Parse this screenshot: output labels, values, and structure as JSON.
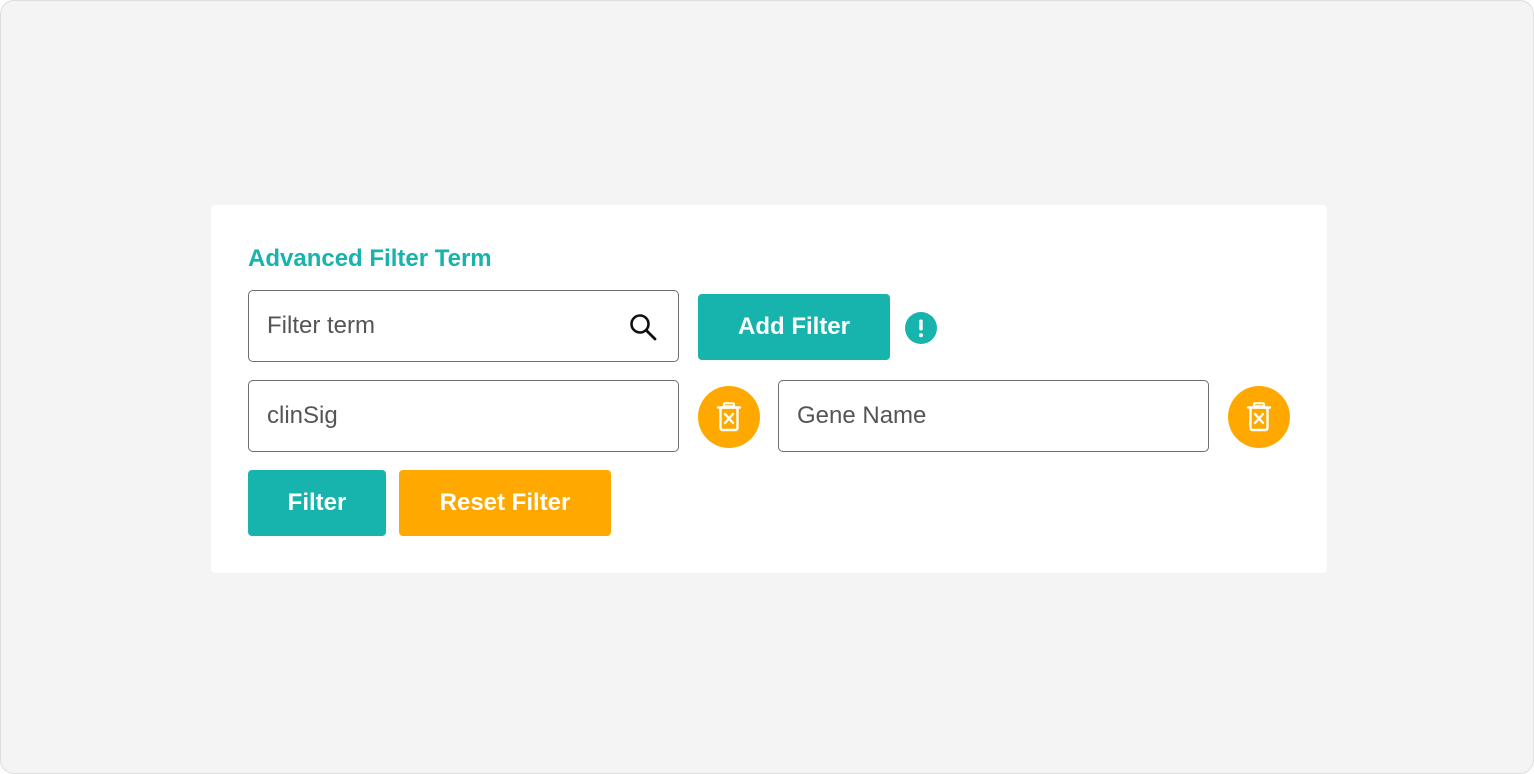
{
  "filter_panel": {
    "title": "Advanced Filter Term",
    "search": {
      "placeholder": "Filter term",
      "value": ""
    },
    "add_filter_label": "Add Filter",
    "info_icon": "exclamation-circle-icon",
    "filters": [
      {
        "value": "clinSig",
        "delete_icon": "trash-x-icon"
      },
      {
        "value": "Gene Name",
        "delete_icon": "trash-x-icon"
      }
    ],
    "filter_label": "Filter",
    "reset_label": "Reset Filter"
  },
  "colors": {
    "teal": "#17b3ad",
    "orange": "#ffa900",
    "background": "#f4f4f4"
  }
}
